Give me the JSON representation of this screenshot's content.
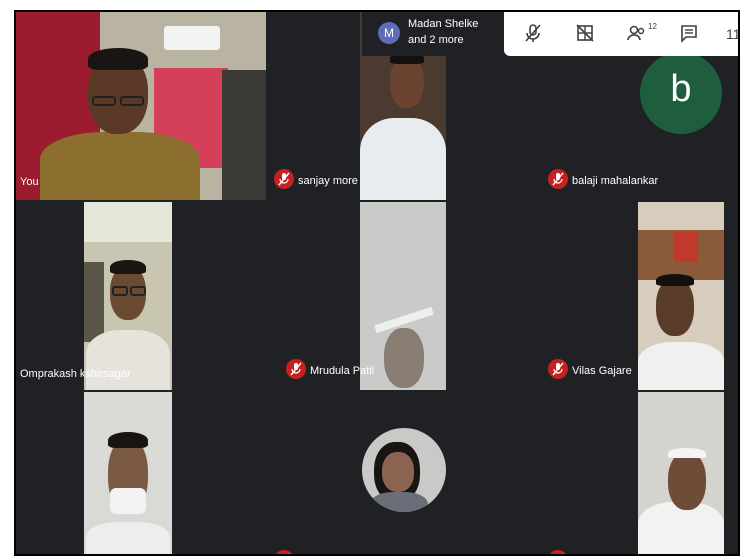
{
  "presenter": {
    "avatar_letter": "M",
    "line1": "Madan Shelke",
    "line2": "and 2 more"
  },
  "controls": {
    "participants_count": "12",
    "overflow_text": "11"
  },
  "tiles": [
    {
      "name": "You",
      "muted": false
    },
    {
      "name": "sanjay more",
      "muted": true
    },
    {
      "name": "balaji mahalankar",
      "muted": true,
      "avatar_letter": "b",
      "avatar_color": "#1e5e3f"
    },
    {
      "name": "Omprakash kshirsagar",
      "muted": false
    },
    {
      "name": "Mrudula Patil",
      "muted": true
    },
    {
      "name": "Vilas Gajare",
      "muted": true
    },
    {
      "name": "",
      "muted": false
    },
    {
      "name": "",
      "muted": true
    },
    {
      "name": "",
      "muted": true
    }
  ],
  "colors": {
    "background": "#202124",
    "muted_badge": "#c5221f",
    "toolbar": "#ffffff"
  }
}
